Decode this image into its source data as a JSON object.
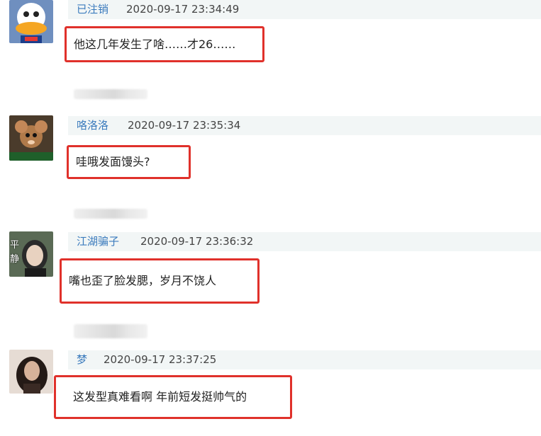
{
  "comments": [
    {
      "user": "已注销",
      "time": "2020-09-17 23:34:49",
      "text": "他这几年发生了啥……才26……",
      "avatar_icon": "donald-duck-avatar-icon"
    },
    {
      "user": "咯洛洛",
      "time": "2020-09-17 23:35:34",
      "text": "哇哦发面馒头?",
      "avatar_icon": "jerry-mouse-avatar-icon"
    },
    {
      "user": "江湖骗子",
      "time": "2020-09-17 23:36:32",
      "text": "嘴也歪了脸发腮，岁月不饶人",
      "avatar_icon": "calm-woman-avatar-icon",
      "avatar_text": "平静"
    },
    {
      "user": "梦",
      "time": "2020-09-17 23:37:25",
      "text": "这发型真难看啊 年前短发挺帅气的",
      "avatar_icon": "woman-portrait-avatar-icon"
    }
  ],
  "colors": {
    "username": "#3b7bbd",
    "highlight_border": "#e0312b",
    "meta_bar_bg": "#f2f6f6"
  }
}
